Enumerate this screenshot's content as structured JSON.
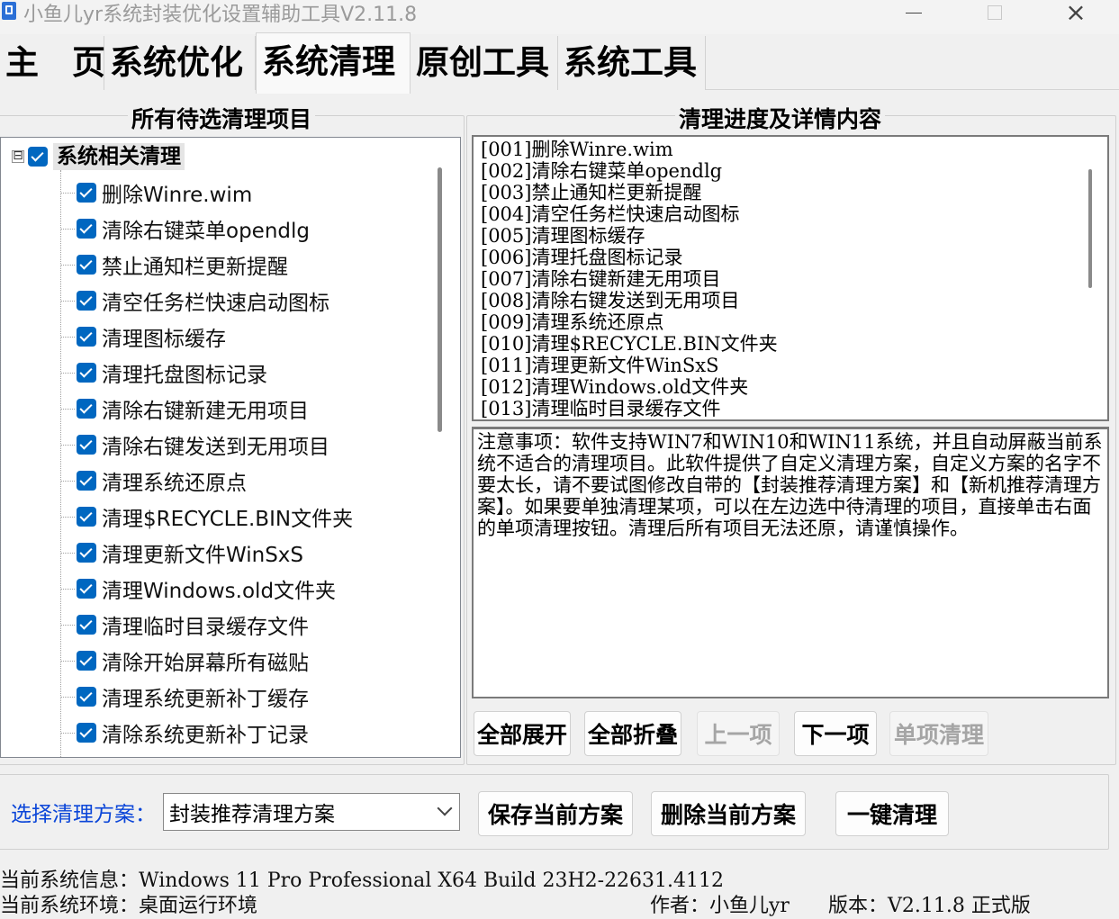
{
  "window": {
    "title": "小鱼儿yr系统封装优化设置辅助工具V2.11.8"
  },
  "tabs": [
    {
      "label": "主　页"
    },
    {
      "label": "系统优化"
    },
    {
      "label": "系统清理"
    },
    {
      "label": "原创工具"
    },
    {
      "label": "系统工具"
    }
  ],
  "left_panel": {
    "title": "所有待选清理项目",
    "root": {
      "label": "系统相关清理",
      "checked": true,
      "expander": "⊟"
    },
    "items": [
      "删除Winre.wim",
      "清除右键菜单opendlg",
      "禁止通知栏更新提醒",
      "清空任务栏快速启动图标",
      "清理图标缓存",
      "清理托盘图标记录",
      "清除右键新建无用项目",
      "清除右键发送到无用项目",
      "清理系统还原点",
      "清理$RECYCLE.BIN文件夹",
      "清理更新文件WinSxS",
      "清理Windows.old文件夹",
      "清理临时目录缓存文件",
      "清除开始屏幕所有磁贴",
      "清理系统更新补丁缓存",
      "清除系统更新补丁记录"
    ]
  },
  "right_panel": {
    "title": "清理进度及详情内容",
    "log": [
      "[001]删除Winre.wim",
      "[002]清除右键菜单opendlg",
      "[003]禁止通知栏更新提醒",
      "[004]清空任务栏快速启动图标",
      "[005]清理图标缓存",
      "[006]清理托盘图标记录",
      "[007]清除右键新建无用项目",
      "[008]清除右键发送到无用项目",
      "[009]清理系统还原点",
      "[010]清理$RECYCLE.BIN文件夹",
      "[011]清理更新文件WinSxS",
      "[012]清理Windows.old文件夹",
      "[013]清理临时目录缓存文件"
    ],
    "notice": "注意事项：软件支持WIN7和WIN10和WIN11系统，并且自动屏蔽当前系统不适合的清理项目。此软件提供了自定义清理方案，自定义方案的名字不要太长，请不要试图修改自带的【封装推荐清理方案】和【新机推荐清理方案】。如果要单独清理某项，可以在左边选中待清理的项目，直接单击右面的单项清理按钮。清理后所有项目无法还原，请谨慎操作。",
    "buttons": {
      "expand_all": "全部展开",
      "collapse_all": "全部折叠",
      "prev": "上一项",
      "next": "下一项",
      "single_clean": "单项清理"
    }
  },
  "scheme": {
    "label": "选择清理方案：",
    "selected": "封装推荐清理方案",
    "save": "保存当前方案",
    "delete": "删除当前方案",
    "one_click": "一键清理"
  },
  "status": {
    "sys_info": "当前系统信息：Windows 11 Pro Professional X64 Build 23H2-22631.4112",
    "sys_env": "当前系统环境：桌面运行环境",
    "author": "作者：小鱼儿yr",
    "version": "版本：V2.11.8 正式版"
  },
  "colors": {
    "accent": "#0067c0",
    "label_blue": "#0a45d8"
  }
}
